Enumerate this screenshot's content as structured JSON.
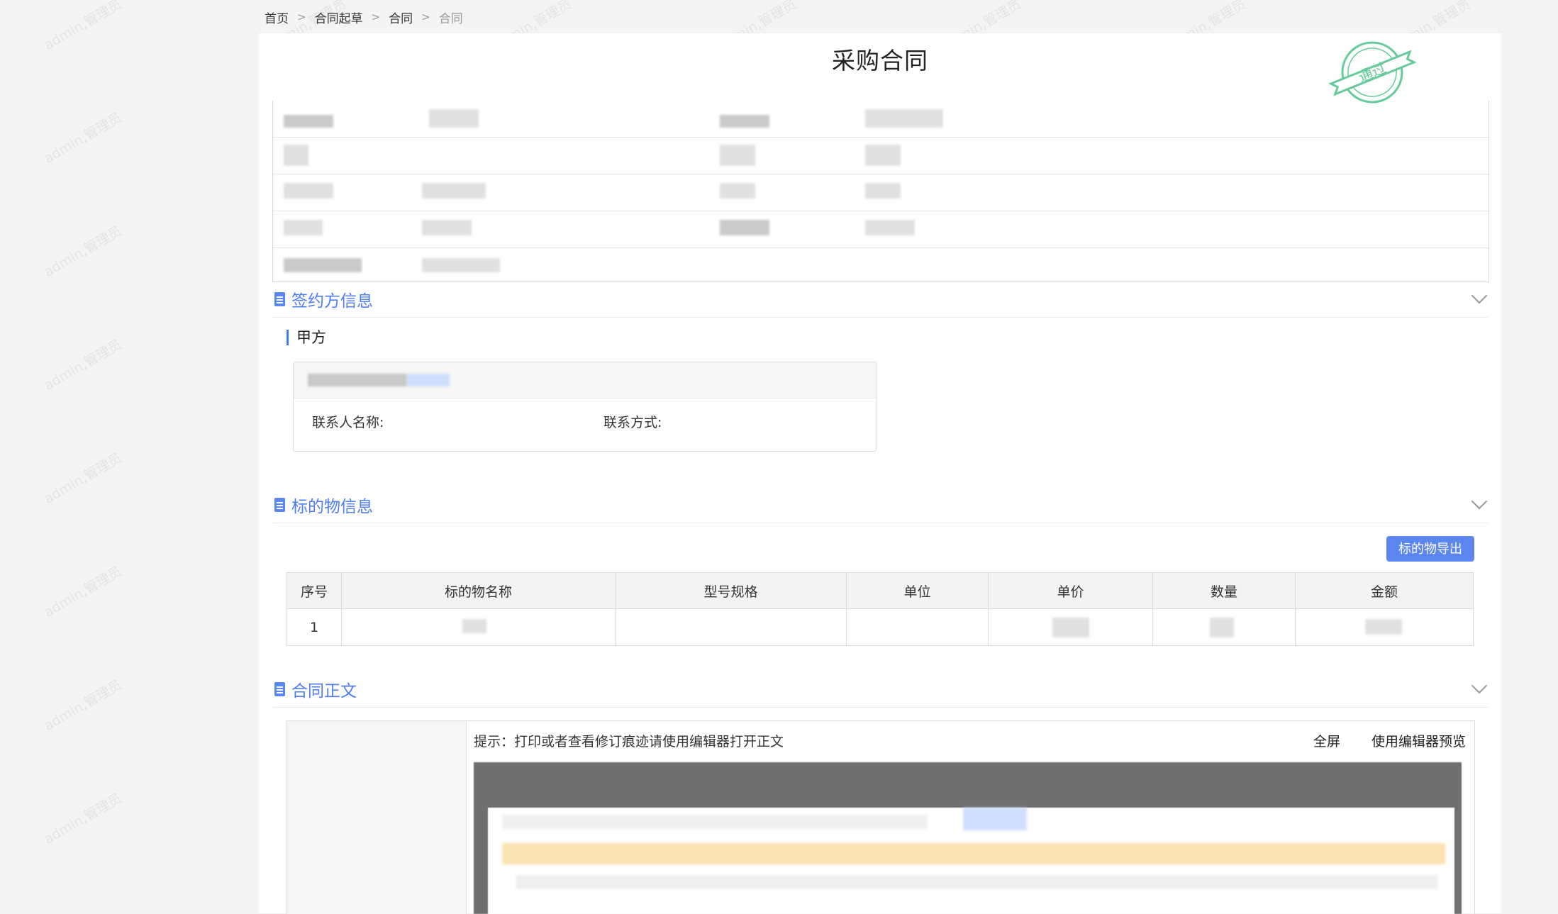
{
  "breadcrumb": [
    "首页",
    "合同起草",
    "合同",
    "合同"
  ],
  "page_title": "采购合同",
  "stamp_text": "通过",
  "sections": {
    "parties": "签约方信息",
    "subject": "标的物信息",
    "body": "合同正文"
  },
  "party_a": {
    "title": "甲方",
    "contact_name_label": "联系人名称:",
    "contact_method_label": "联系方式:"
  },
  "subject": {
    "export_label": "标的物导出",
    "columns": [
      "序号",
      "标的物名称",
      "型号规格",
      "单位",
      "单价",
      "数量",
      "金额"
    ],
    "rows": [
      [
        "1",
        "",
        "",
        "",
        "",
        "",
        ""
      ]
    ]
  },
  "contract_body": {
    "hint": "提示：打印或者查看修订痕迹请使用编辑器打开正文",
    "fullscreen": "全屏",
    "editor_preview": "使用编辑器预览"
  },
  "watermark": "admin,管理员",
  "colors": {
    "accent": "#5b86f0",
    "stamp": "#4cc38a"
  }
}
